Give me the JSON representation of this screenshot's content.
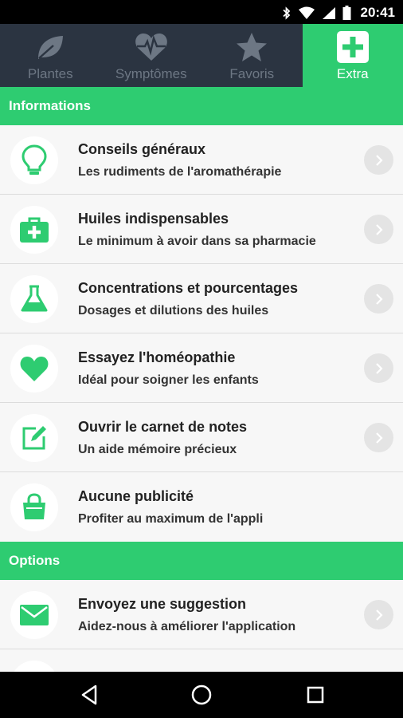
{
  "status_bar": {
    "time": "20:41",
    "icons": [
      "bluetooth-icon",
      "wifi-icon",
      "signal-icon",
      "battery-icon"
    ]
  },
  "tabs": [
    {
      "label": "Plantes",
      "icon": "leaf-icon",
      "active": false
    },
    {
      "label": "Symptômes",
      "icon": "heart-pulse-icon",
      "active": false
    },
    {
      "label": "Favoris",
      "icon": "star-icon",
      "active": false
    },
    {
      "label": "Extra",
      "icon": "plus-box-icon",
      "active": true
    }
  ],
  "sections": {
    "informations": {
      "title": "Informations",
      "items": [
        {
          "title": "Conseils généraux",
          "subtitle": "Les rudiments de l'aromathérapie",
          "icon": "lightbulb-icon"
        },
        {
          "title": "Huiles indispensables",
          "subtitle": "Le minimum à avoir dans sa pharmacie",
          "icon": "first-aid-kit-icon"
        },
        {
          "title": "Concentrations et pourcentages",
          "subtitle": "Dosages et dilutions des huiles",
          "icon": "flask-icon"
        },
        {
          "title": "Essayez l'homéopathie",
          "subtitle": "Idéal pour soigner les enfants",
          "icon": "heart-icon"
        },
        {
          "title": "Ouvrir le carnet de notes",
          "subtitle": "Un aide mémoire précieux",
          "icon": "edit-note-icon"
        },
        {
          "title": "Aucune publicité",
          "subtitle": "Profiter au maximum de l'appli",
          "icon": "shopping-bag-icon"
        }
      ]
    },
    "options": {
      "title": "Options",
      "items": [
        {
          "title": "Envoyez une suggestion",
          "subtitle": "Aidez-nous à améliorer l'application",
          "icon": "envelope-icon"
        }
      ]
    }
  },
  "colors": {
    "accent": "#2ecc71",
    "tab_bar": "#2b3441",
    "tab_inactive": "#6d7784",
    "list_bg": "#f7f7f7"
  },
  "nav_bar": {
    "buttons": [
      "back-icon",
      "home-icon",
      "recents-icon"
    ]
  }
}
